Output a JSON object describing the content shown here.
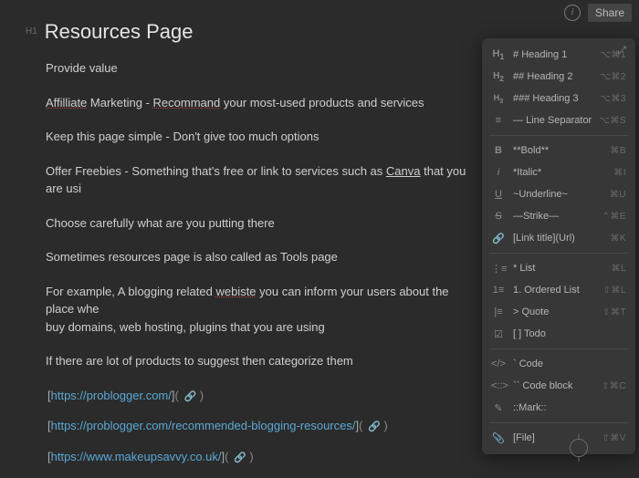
{
  "topbar": {
    "share": "Share"
  },
  "title": {
    "tag": "H1",
    "text": "Resources Page"
  },
  "paragraphs": {
    "p1": "Provide value",
    "p2a": "Affilliate",
    "p2b": " Marketing - ",
    "p2c": "Recommand",
    "p2d": " your most-used products and services",
    "p3": "Keep this page simple - Don't give too much options",
    "p4a": "Offer Freebies - Something that's free or link to services such as ",
    "p4b": "Canva",
    "p4c": " that you are usi",
    "p5": "Choose carefully what are you putting there",
    "p6": "Sometimes resources page is also called as Tools page",
    "p7a": "For example, A blogging related ",
    "p7b": "webiste",
    "p7c": " you can inform your users about the place whe",
    "p7d": "buy domains, web hosting, plugins that you are using",
    "p8": "If there are lot of products to suggest then categorize them"
  },
  "links": {
    "l1": "https://problogger.com/",
    "l2": "https://problogger.com/recommended-blogging-resources/",
    "l3": "https://www.makeupsavvy.co.uk/"
  },
  "menu": {
    "h1": {
      "label": "Heading 1",
      "prefix": "#",
      "sc": "⌥⌘1"
    },
    "h2": {
      "label": "Heading 2",
      "prefix": "##",
      "sc": "⌥⌘2"
    },
    "h3": {
      "label": "Heading 3",
      "prefix": "###",
      "sc": "⌥⌘3"
    },
    "sep": {
      "label": "Line Separator",
      "prefix": "—",
      "sc": "⌥⌘S"
    },
    "bold": {
      "label": "**Bold**",
      "sc": "⌘B"
    },
    "italic": {
      "label": "*Italic*",
      "sc": "⌘I"
    },
    "underline": {
      "label": "~Underline~",
      "sc": "⌘U"
    },
    "strike": {
      "label": "—Strike—",
      "sc": "⌃⌘E"
    },
    "link": {
      "label": "[Link title](Url)",
      "sc": "⌘K"
    },
    "list": {
      "label": "List",
      "prefix": "*",
      "sc": "⌘L"
    },
    "olist": {
      "label": "Ordered List",
      "prefix": "1.",
      "sc": "⇧⌘L"
    },
    "quote": {
      "label": "Quote",
      "prefix": ">",
      "sc": "⇧⌘T"
    },
    "todo": {
      "label": "Todo",
      "prefix": "[ ]",
      "sc": ""
    },
    "code": {
      "label": "Code",
      "prefix": "`",
      "sc": ""
    },
    "codeblock": {
      "label": "Code block",
      "prefix": "``",
      "sc": "⇧⌘C"
    },
    "mark": {
      "label": "::Mark::",
      "sc": ""
    },
    "file": {
      "label": "[File]",
      "sc": "⇧⌘V"
    }
  }
}
